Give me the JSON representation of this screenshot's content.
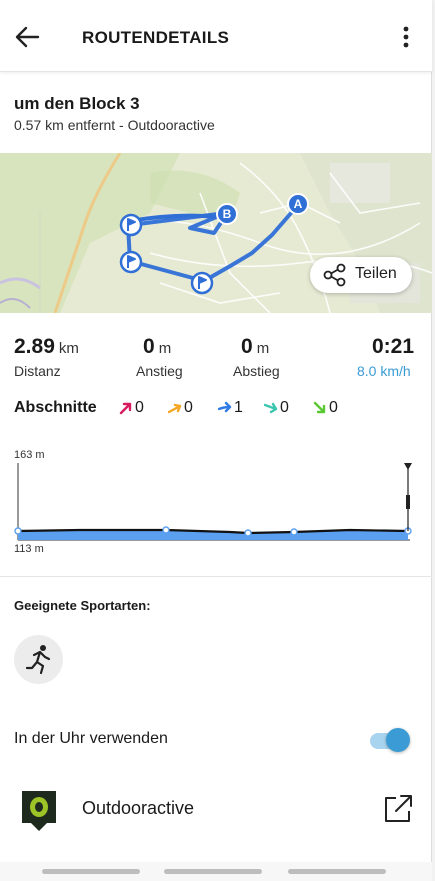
{
  "header": {
    "title": "ROUTENDETAILS"
  },
  "route": {
    "name": "um den Block 3",
    "subtitle": "0.57 km entfernt - Outdooractive"
  },
  "map": {
    "share_label": "Teilen",
    "marker_a": "A",
    "marker_b": "B",
    "route_color": "#2f6fd6"
  },
  "stats": {
    "distance": {
      "value": "2.89",
      "unit": "km",
      "label": "Distanz"
    },
    "ascent": {
      "value": "0",
      "unit": "m",
      "label": "Anstieg"
    },
    "descent": {
      "value": "0",
      "unit": "m",
      "label": "Abstieg"
    },
    "duration": {
      "value": "0:21",
      "label": "8.0 km/h"
    }
  },
  "sections": {
    "title": "Abschnitte",
    "items": [
      {
        "icon": "steep-up-arrow-icon",
        "color": "#d81b60",
        "count": "0"
      },
      {
        "icon": "up-arrow-icon",
        "color": "#f5a623",
        "count": "0"
      },
      {
        "icon": "flat-arrow-icon",
        "color": "#2f7be5",
        "count": "1"
      },
      {
        "icon": "down-arrow-icon",
        "color": "#3cc6b0",
        "count": "0"
      },
      {
        "icon": "steep-down-arrow-icon",
        "color": "#5ac832",
        "count": "0"
      }
    ]
  },
  "elevation": {
    "max_label": "163 m",
    "min_label": "113 m",
    "fill_color": "#5b9ff0"
  },
  "sports": {
    "title": "Geeignete Sportarten:",
    "icon": "running-icon"
  },
  "watch": {
    "label": "In der Uhr verwenden",
    "enabled": true
  },
  "source": {
    "label": "Outdooractive",
    "logo_letter": "O"
  }
}
